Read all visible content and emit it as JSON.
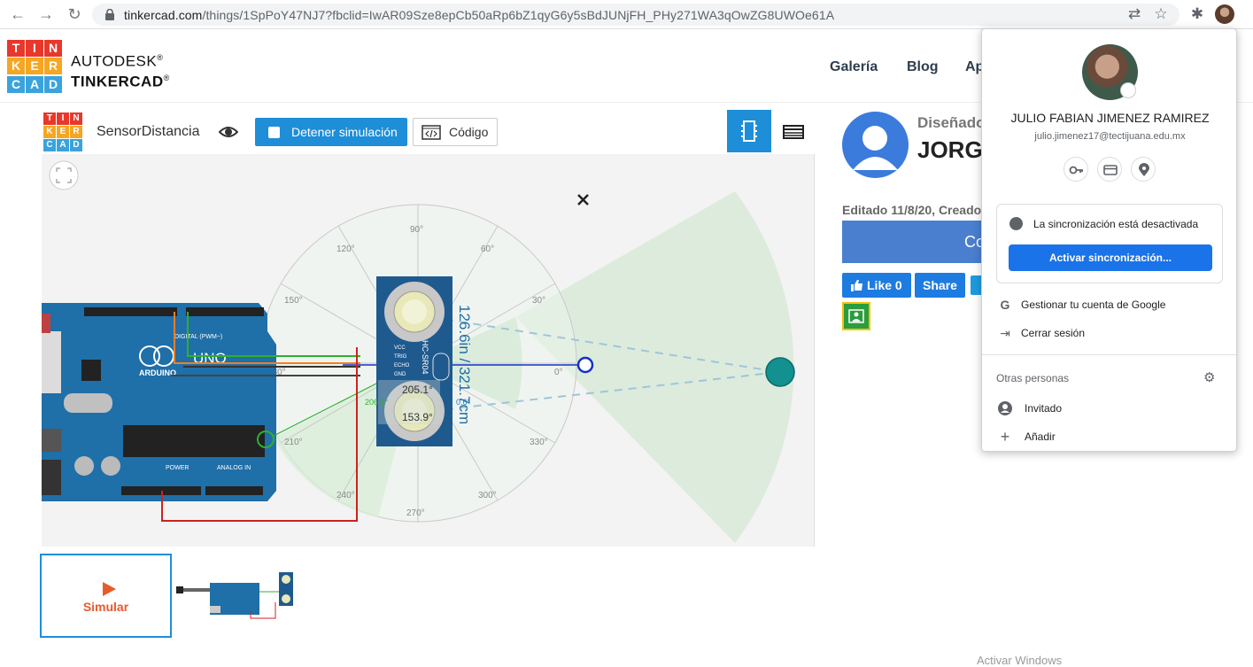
{
  "browser": {
    "url_host": "tinkercad.com",
    "url_path": "/things/1SpPoY47NJ7?fbclid=IwAR09Sze8epCb50aRp6bZ1qyG6y5sBdJUNjFH_PHy271WA3qOwZG8UWOe61A"
  },
  "header": {
    "logo_letters": [
      "T",
      "I",
      "N",
      "K",
      "E",
      "R",
      "C",
      "A",
      "D"
    ],
    "logo_colors": [
      "#e8382c",
      "#e8382c",
      "#e8382c",
      "#f5a623",
      "#f5a623",
      "#f5a623",
      "#3aa3dd",
      "#3aa3dd",
      "#3aa3dd"
    ],
    "brand_line1": "AUTODESK",
    "brand_line2": "TINKERCAD",
    "brand_reg": "®",
    "nav": [
      "Galería",
      "Blog",
      "Ap"
    ]
  },
  "editor": {
    "project_title": "SensorDistancia",
    "stop_button": "Detener simulación",
    "code_button": "Código"
  },
  "sensor": {
    "angles": [
      "90°",
      "60°",
      "30°",
      "0°",
      "330°",
      "300°",
      "270°",
      "240°",
      "210°",
      "180°",
      "150°",
      "120°"
    ],
    "distance_label": "126.6in / 321.7cm",
    "angle_reading_1": "205.1°",
    "angle_reading_2": "153.9°",
    "angle_small_1": "206.1°",
    "angle_small_2": "0.6°",
    "model": "HC-SR04",
    "pins": [
      "VCC",
      "TRIG",
      "ECHO",
      "GND"
    ]
  },
  "arduino": {
    "brand": "ARDUINO",
    "model": "UNO",
    "digital_label": "DIGITAL (PWM~)",
    "power_label": "POWER",
    "analog_label": "ANALOG IN"
  },
  "thumbnails": {
    "simulate_label": "Simular"
  },
  "author": {
    "designed_by_label": "Diseñado",
    "name": "JORG",
    "edited": "Editado 11/8/20, Creado",
    "copy_button": "Co",
    "like_button": "Like 0",
    "share_button": "Share"
  },
  "profile_menu": {
    "name": "JULIO FABIAN JIMENEZ RAMIREZ",
    "email": "julio.jimenez17@tectijuana.edu.mx",
    "sync_status": "La sincronización está desactivada",
    "sync_button": "Activar sincronización...",
    "manage_account": "Gestionar tu cuenta de Google",
    "sign_out": "Cerrar sesión",
    "other_people": "Otras personas",
    "guest": "Invitado",
    "add": "Añadir"
  },
  "footer_partial": "Activar Windows"
}
